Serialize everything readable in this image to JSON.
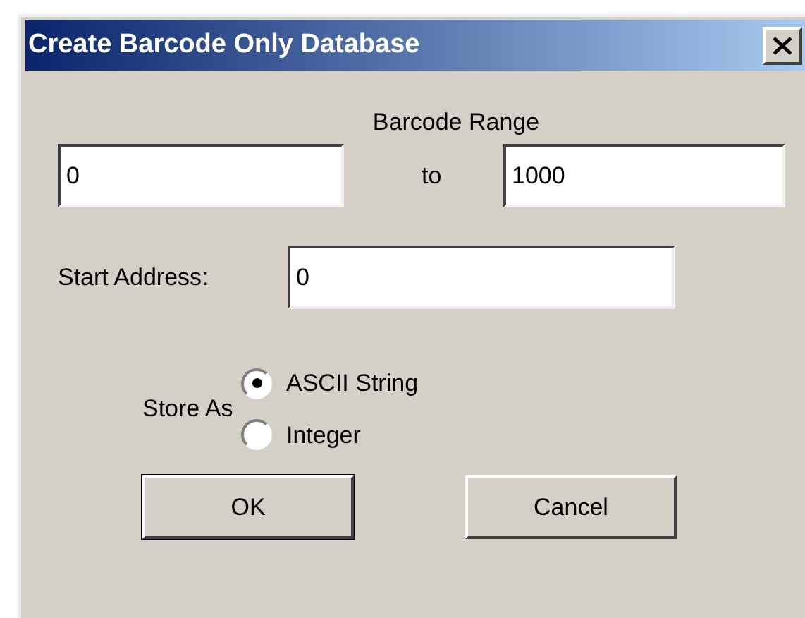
{
  "window": {
    "title": "Create Barcode Only Database"
  },
  "range": {
    "label": "Barcode Range",
    "from": "0",
    "separator": "to",
    "to": "1000"
  },
  "start_address": {
    "label": "Start Address:",
    "value": "0"
  },
  "store_as": {
    "label": "Store As",
    "options": [
      {
        "label": "ASCII String",
        "selected": true
      },
      {
        "label": "Integer",
        "selected": false
      }
    ]
  },
  "buttons": [
    {
      "label": "OK",
      "default": true
    },
    {
      "label": "Cancel",
      "default": false
    }
  ]
}
